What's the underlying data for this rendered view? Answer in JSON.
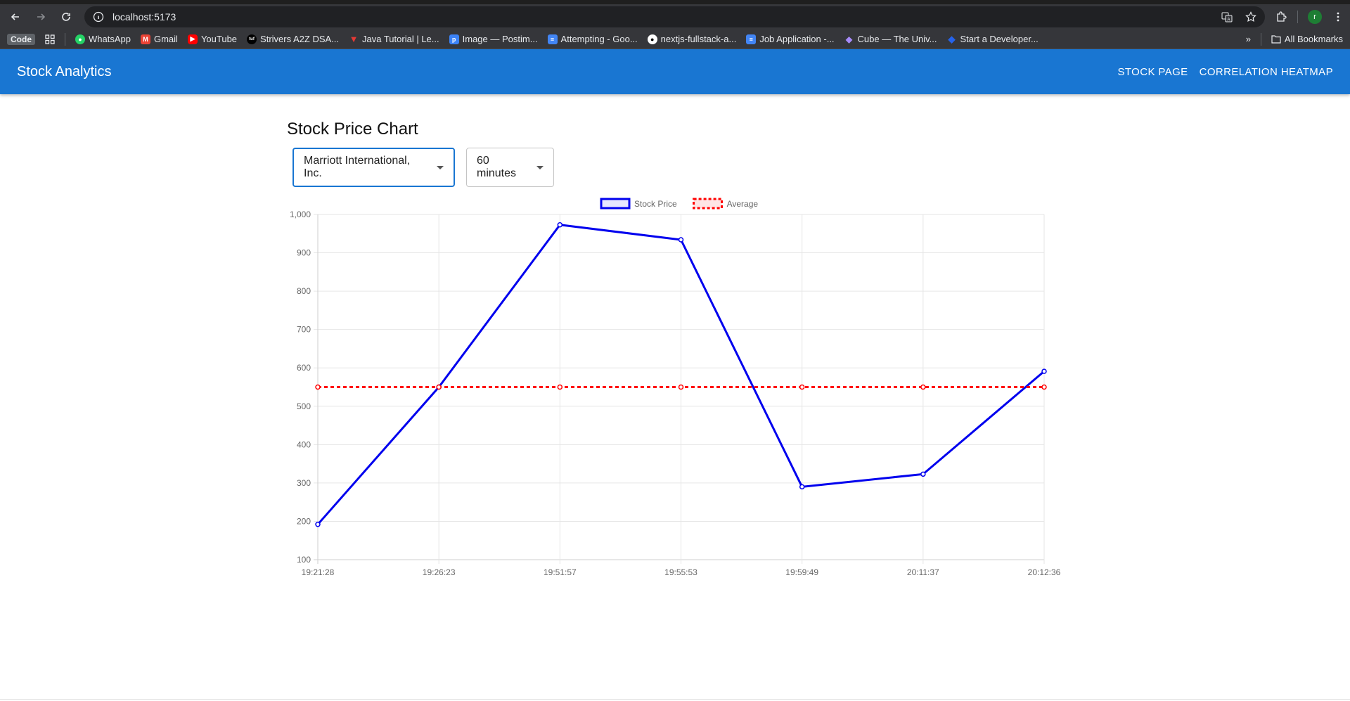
{
  "browser": {
    "url": "localhost:5173",
    "bookmarks": [
      {
        "label": "Code",
        "icon": "code-badge"
      },
      {
        "label": "",
        "icon": "apps-grid-icon"
      },
      {
        "label": "WhatsApp",
        "icon": "whatsapp-icon",
        "color": "#25d366"
      },
      {
        "label": "Gmail",
        "icon": "gmail-icon",
        "color": "#ea4335"
      },
      {
        "label": "YouTube",
        "icon": "youtube-icon",
        "color": "#ff0000"
      },
      {
        "label": "Strivers A2Z DSA...",
        "icon": "tuf-icon",
        "color": "#000000"
      },
      {
        "label": "Java Tutorial | Le...",
        "icon": "java-icon",
        "color": "#e53935"
      },
      {
        "label": "Image — Postim...",
        "icon": "postimage-icon",
        "color": "#3b82f6"
      },
      {
        "label": "Attempting - Goo...",
        "icon": "docs-icon",
        "color": "#4285f4"
      },
      {
        "label": "nextjs-fullstack-a...",
        "icon": "github-icon",
        "color": "#ffffff"
      },
      {
        "label": "Job Application -...",
        "icon": "docs-icon",
        "color": "#4285f4"
      },
      {
        "label": "Cube — The Univ...",
        "icon": "cube-icon",
        "color": "#7c3aed"
      },
      {
        "label": "Start a Developer...",
        "icon": "diamond-icon",
        "color": "#2563eb"
      }
    ],
    "all_bookmarks": "All Bookmarks",
    "avatar_letter": "r"
  },
  "appbar": {
    "brand": "Stock Analytics",
    "links": [
      "STOCK PAGE",
      "CORRELATION HEATMAP"
    ],
    "color": "#1976d2"
  },
  "main": {
    "title": "Stock Price Chart",
    "stock_select": "Marriott International, Inc.",
    "window_select": "60 minutes"
  },
  "chart_data": {
    "type": "line",
    "x": [
      "19:21:28",
      "19:26:23",
      "19:51:57",
      "19:55:53",
      "19:59:49",
      "20:11:37",
      "20:12:36"
    ],
    "series": [
      {
        "name": "Stock Price",
        "values": [
          192,
          550,
          973,
          934,
          290,
          323,
          591
        ],
        "color": "#0000ee",
        "style": "solid"
      },
      {
        "name": "Average",
        "values": [
          550,
          550,
          550,
          550,
          550,
          550,
          550
        ],
        "color": "#ff0000",
        "style": "dashed"
      }
    ],
    "ylim": [
      100,
      1000
    ],
    "yticks": [
      "100",
      "200",
      "300",
      "400",
      "500",
      "600",
      "700",
      "800",
      "900",
      "1,000"
    ],
    "grid": true,
    "legend": "top-center"
  }
}
